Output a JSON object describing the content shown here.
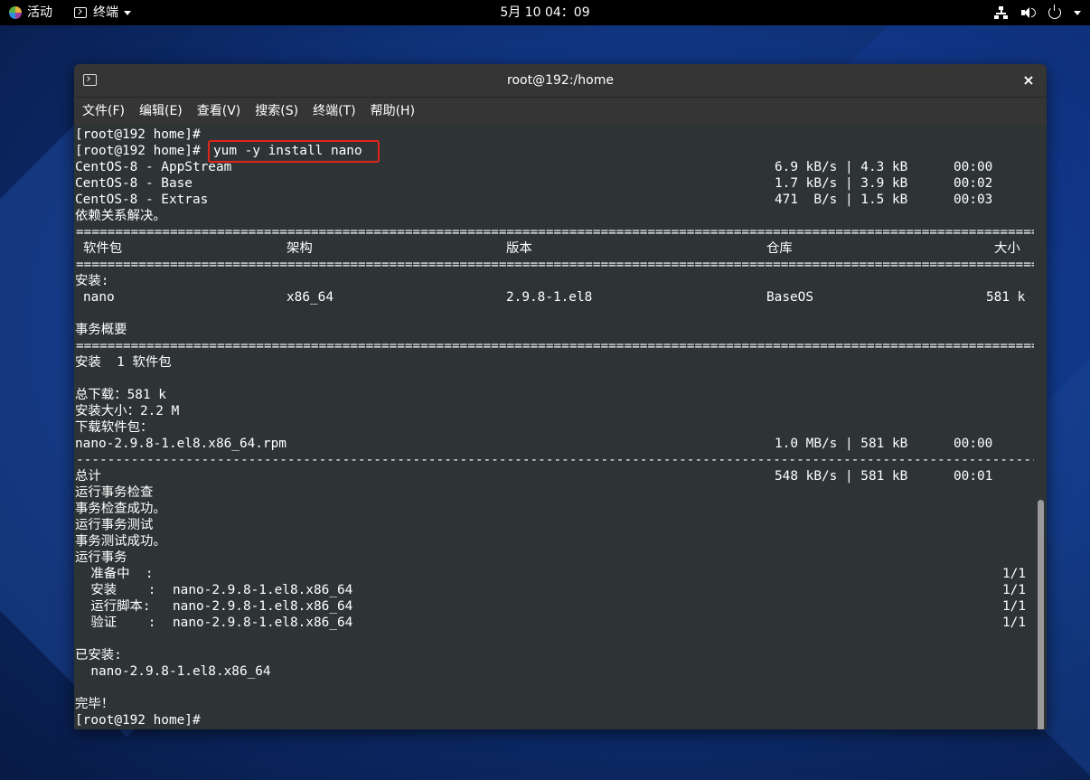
{
  "topbar": {
    "activities": "活动",
    "app_name": "终端",
    "clock": "5月 10 04：09"
  },
  "window": {
    "title": "root@192:/home",
    "close": "×",
    "menu": [
      "文件(F)",
      "编辑(E)",
      "查看(V)",
      "搜索(S)",
      "终端(T)",
      "帮助(H)"
    ]
  },
  "terminal": {
    "prompt1": "[root@192 home]#",
    "prompt2": "[root@192 home]#",
    "command": "yum -y install nano",
    "repos": [
      {
        "name": "CentOS-8 - AppStream",
        "speed": "6.9 kB/s | 4.3 kB",
        "time": "00:00"
      },
      {
        "name": "CentOS-8 - Base",
        "speed": "1.7 kB/s | 3.9 kB",
        "time": "00:02"
      },
      {
        "name": "CentOS-8 - Extras",
        "speed": "471  B/s | 1.5 kB",
        "time": "00:03"
      }
    ],
    "deps_resolved": "依赖关系解决。",
    "rule_eq": "==========================================================================================================================================================",
    "rule_dash": "----------------------------------------------------------------------------------------------------------------------------------------------------------",
    "table_headers": {
      "package": "软件包",
      "arch": "架构",
      "version": "版本",
      "repo": "仓库",
      "size": "大小"
    },
    "install_label": "安装:",
    "package_row": {
      "package": "nano",
      "arch": "x86_64",
      "version": "2.9.8-1.el8",
      "repo": "BaseOS",
      "size": "581 k"
    },
    "summary_title": "事务概要",
    "install_count": "安装  1 软件包",
    "total_download": "总下载：581 k",
    "install_size": "安装大小：2.2 M",
    "downloading": "下载软件包：",
    "rpm": {
      "name": "nano-2.9.8-1.el8.x86_64.rpm",
      "speed": "1.0 MB/s | 581 kB",
      "time": "00:00"
    },
    "total": {
      "label": "总计",
      "speed": "548 kB/s | 581 kB",
      "time": "00:01"
    },
    "steps": [
      "运行事务检查",
      "事务检查成功。",
      "运行事务测试",
      "事务测试成功。",
      "运行事务"
    ],
    "tx": [
      {
        "label": "  准备中  :",
        "pkg": "",
        "count": "1/1"
      },
      {
        "label": "  安装    :",
        "pkg": "nano-2.9.8-1.el8.x86_64",
        "count": "1/1"
      },
      {
        "label": "  运行脚本:",
        "pkg": "nano-2.9.8-1.el8.x86_64",
        "count": "1/1"
      },
      {
        "label": "  验证    :",
        "pkg": "nano-2.9.8-1.el8.x86_64",
        "count": "1/1"
      }
    ],
    "installed_label": "已安装:",
    "installed_pkg": "  nano-2.9.8-1.el8.x86_64",
    "done": "完毕！",
    "prompt3": "[root@192 home]#"
  },
  "colors": {
    "highlight": "#e0241b",
    "terminal_bg": "#2e3436"
  }
}
